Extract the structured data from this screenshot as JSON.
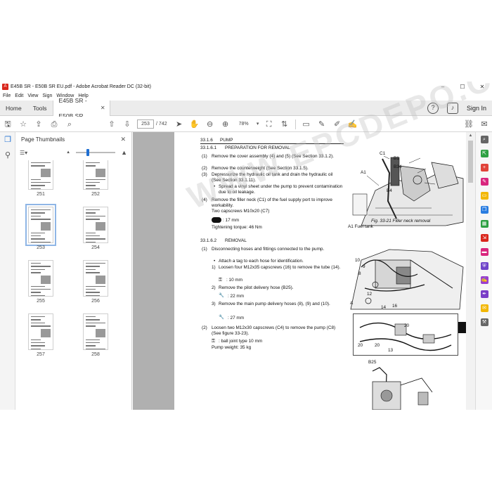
{
  "window": {
    "title": "E45B SR - E50B SR EU.pdf - Adobe Acrobat Reader DC (32-bit)",
    "app_icon": "acrobat-icon",
    "minimize": "–",
    "close": "✕"
  },
  "menu": [
    "File",
    "Edit",
    "View",
    "Sign",
    "Window",
    "Help"
  ],
  "tabs": {
    "home": "Home",
    "tools": "Tools",
    "doc": "E45B SR - E50B SR ...",
    "sign_in": "Sign In"
  },
  "toolbar": {
    "page_current": "253",
    "page_sep": "/",
    "page_total": "742",
    "zoom": "78%"
  },
  "thumb_panel": {
    "title": "Page Thumbnails",
    "close": "✕"
  },
  "thumbnails": [
    {
      "num": "251"
    },
    {
      "num": "252"
    },
    {
      "num": "253",
      "selected": true
    },
    {
      "num": "254"
    },
    {
      "num": "255"
    },
    {
      "num": "256"
    },
    {
      "num": "257"
    },
    {
      "num": "258"
    }
  ],
  "doc": {
    "s1": "33.1.6",
    "s1_title": "PUMP",
    "s2": "33.1.6.1",
    "s2_title": "PREPARATION FOR REMOVAL",
    "p1": "(1)",
    "p1_text": "Remove the cover assembly (4) and (5) (See Section 33.1.2).",
    "p2": "(2)",
    "p2_text": "Remove the counterweight (See Section 33.1.5).",
    "p3": "(3)",
    "p3_text": "Depressurize the hydraulic oil tank and drain the hydraulic oil (See Section 33.1.11).",
    "p3_bullet": "Spread a vinyl sheet under the pump to prevent contamination due to oil leakage.",
    "p4": "(4)",
    "p4_text": "Remove the filler neck (C1) of the fuel supply port to improve workability.",
    "p4_caps": "Two capscrews M10x20 (C7)",
    "p4_tool": ": 17 mm",
    "p4_torque": "Tightening torque: 46 Nm",
    "s3": "33.1.6.2",
    "s3_title": "REMOVAL",
    "r1": "(1)",
    "r1_text": "Disconnecting hoses and fittings connected to the pump.",
    "r1_bullet": "Attach a tag to each hose for identification.",
    "r1_1": "1)",
    "r1_1_text": "Loosen four M12x35 capscrews (16) to remove the tube (14).",
    "r1_1_tool": ": 10 mm",
    "r1_2": "2)",
    "r1_2_text": "Remove the pilot delivery hose (B25).",
    "r1_2_tool": ": 22 mm",
    "r1_3": "3)",
    "r1_3_text": "Remove the main pump delivery hoses (8), (9) and (10).",
    "r1_3_tool": ": 27 mm",
    "r2": "(2)",
    "r2_text": "Loosen two M12x30 capscrews (C4) to remove the pump (C8) (See figure 33-23).",
    "r2_tool": ": ball joint type 10 mm",
    "r2_weight": "Pump weight: 35 kg",
    "fig1_caption": "Fig. 33-21 Filler neck removal",
    "fig1_legend": "A1 Fuel tank",
    "labels": {
      "B1": "B1",
      "B34": "B34",
      "A1": "A1",
      "B4": "B4",
      "C1": "C1",
      "C4": "C4",
      "B25": "B25",
      "n10": "10",
      "n9": "9",
      "n8": "8",
      "n12": "12",
      "n14": "14",
      "n16": "16",
      "n20a": "20",
      "n20b": "20",
      "n20c": "20",
      "n13": "13",
      "A": "A"
    }
  },
  "watermark": "WWW.EPCDEPO.COM",
  "colors": {
    "accent": "#1f6fd2",
    "acrobat_red": "#d9261c",
    "doc_bg": "#b0b0b0"
  }
}
